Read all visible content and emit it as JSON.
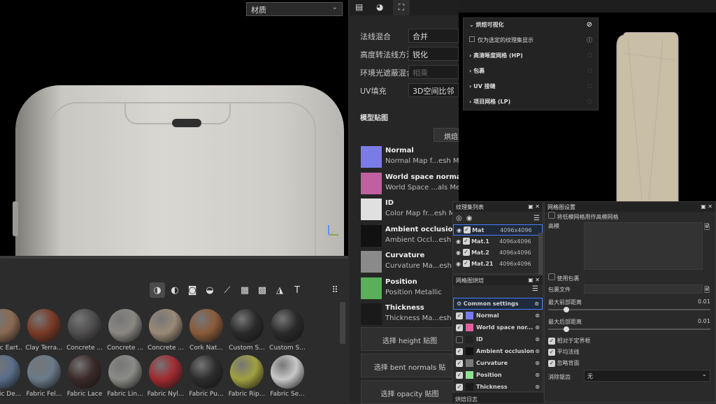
{
  "viewport": {
    "material_select": "材质"
  },
  "shelf": {
    "tools": [
      "material-icon",
      "smart-material-icon",
      "mask-icon",
      "filter-icon",
      "brush-icon",
      "alpha-icon",
      "grid-texture-icon",
      "environment-icon",
      "font-icon"
    ],
    "row1": [
      {
        "label": "Fabric Eart...",
        "color": "#8a6a52"
      },
      {
        "label": "Clay Terra...",
        "color": "#7a3a26"
      },
      {
        "label": "Concrete ...",
        "color": "#4e4c4c"
      },
      {
        "label": "Concrete ...",
        "color": "#8a8782"
      },
      {
        "label": "Concrete ...",
        "color": "#9a8a76"
      },
      {
        "label": "Cork Nat...",
        "color": "#8a5a3a"
      },
      {
        "label": "Custom S...",
        "color": "#2a2a2a"
      },
      {
        "label": "Custom S...",
        "color": "#2a2a2a"
      }
    ],
    "row2": [
      {
        "label": "Fabric De...",
        "color": "#5a6e8a"
      },
      {
        "label": "Fabric Fel...",
        "color": "#6a7a8a"
      },
      {
        "label": "Fabric Lace",
        "color": "#3a2a28"
      },
      {
        "label": "Fabric Lin...",
        "color": "#8a8a86"
      },
      {
        "label": "Fabric Nyl...",
        "color": "#a02a30"
      },
      {
        "label": "Fabric Pu...",
        "color": "#2c2c2c"
      },
      {
        "label": "Fabric Rip...",
        "color": "#a0a040"
      },
      {
        "label": "Fabric Se...",
        "color": "#c8c8c8"
      }
    ]
  },
  "bake": {
    "fields": [
      {
        "label": "法线混合",
        "value": "合并"
      },
      {
        "label": "高度转法线方法",
        "value": "锐化"
      },
      {
        "label": "环境光遮蔽混合",
        "value": "相乘"
      },
      {
        "label": "UV填充",
        "value": "3D空间比邻"
      }
    ],
    "section_title": "模型贴图",
    "bake_button": "烘焙",
    "maps": [
      {
        "title": "Normal",
        "sub": "Normal Map f...esh Me"
      },
      {
        "title": "World space normal",
        "sub": "World Space ...als Meta"
      },
      {
        "title": "ID",
        "sub": "Color Map fr...esh Me"
      },
      {
        "title": "Ambient occlusion",
        "sub": "Ambient Occl...esh Me"
      },
      {
        "title": "Curvature",
        "sub": "Curvature Ma...esh Me"
      },
      {
        "title": "Position",
        "sub": "Position Metallic"
      },
      {
        "title": "Thickness",
        "sub": "Thickness Ma...esh Me"
      }
    ],
    "select_buttons": [
      "选择 height 贴图",
      "选择 bent normals 贴",
      "选择 opacity 贴图"
    ]
  },
  "popup": {
    "title": "烘焙可视化",
    "checkbox_label": "仅为选定的纹理集显示",
    "items": [
      "高清晰度网格 (HP)",
      "包裹",
      "UV 接缝",
      "项目网格 (LP)"
    ]
  },
  "texture_sets": {
    "title": "纹理集列表",
    "rows": [
      {
        "name": "Mat",
        "size": "4096x4096"
      },
      {
        "name": "Mat.1",
        "size": "4096x4096"
      },
      {
        "name": "Mat.2",
        "size": "4096x4096"
      },
      {
        "name": "Mat.21",
        "size": "4096x4096"
      }
    ]
  },
  "mesh_bake": {
    "title": "网格图烘焙",
    "rows": [
      {
        "name": "Common settings",
        "checked": null,
        "color": ""
      },
      {
        "name": "Normal",
        "checked": true,
        "color": "#7a7af0"
      },
      {
        "name": "World space nor...",
        "checked": true,
        "color": "#e0609a"
      },
      {
        "name": "ID",
        "checked": false,
        "color": "#222222"
      },
      {
        "name": "Ambient occlusion",
        "checked": true,
        "color": "#111111"
      },
      {
        "name": "Curvature",
        "checked": true,
        "color": "#7a7a7a"
      },
      {
        "name": "Position",
        "checked": true,
        "color": "#90e090"
      },
      {
        "name": "Thickness",
        "checked": true,
        "color": "#1a1a1a"
      }
    ]
  },
  "mesh_settings": {
    "title": "网格图设置",
    "top_checkbox": "将低模网格用作高模网格",
    "high_mesh_label": "高模",
    "use_cage": "使用包裹",
    "cage_file": "包裹文件",
    "max_front": "最大前部距离",
    "max_front_val": "0.01",
    "max_rear": "最大后部距离",
    "max_rear_val": "0.01",
    "checks": [
      "相对于定界框",
      "平均法线",
      "忽略背面"
    ],
    "antialias_label": "消除锯齿",
    "antialias_value": "无"
  },
  "bake_log": {
    "title": "烘焙日志"
  }
}
